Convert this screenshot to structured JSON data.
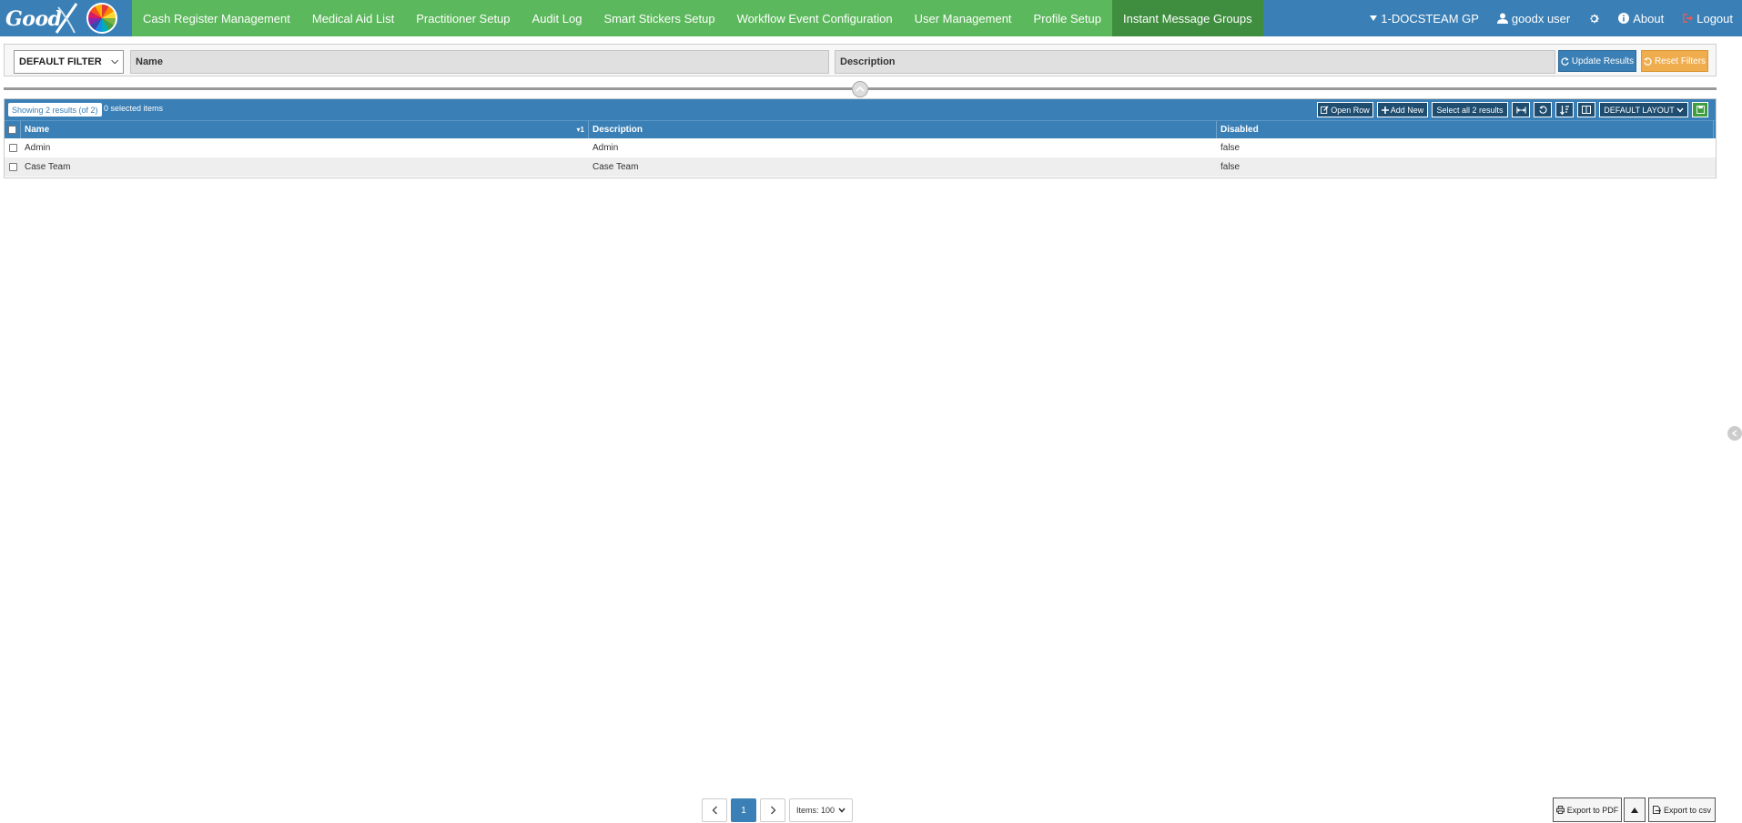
{
  "brand": {
    "logo_text": "Good"
  },
  "nav": {
    "items": [
      {
        "label": "Cash Register Management"
      },
      {
        "label": "Medical Aid List"
      },
      {
        "label": "Practitioner Setup"
      },
      {
        "label": "Audit Log"
      },
      {
        "label": "Smart Stickers Setup"
      },
      {
        "label": "Workflow Event Configuration"
      },
      {
        "label": "User Management"
      },
      {
        "label": "Profile Setup"
      },
      {
        "label": "Instant Message Groups",
        "active": true
      }
    ],
    "practice": "1-DOCSTEAM GP",
    "user": "goodx user",
    "about": "About",
    "logout": "Logout"
  },
  "filter": {
    "selected": "DEFAULT FILTER",
    "name_placeholder": "Name",
    "description_placeholder": "Description",
    "update_label": "Update Results",
    "reset_label": "Reset Filters"
  },
  "grid": {
    "showing": "Showing 2 results (of 2)",
    "selected": "0 selected items",
    "toolbar": {
      "open_row": "Open Row",
      "add_new": "Add New",
      "select_all": "Select all 2 results",
      "layout": "DEFAULT LAYOUT"
    },
    "columns": [
      "Name",
      "Description",
      "Disabled"
    ],
    "sort_indicator": "1",
    "rows": [
      {
        "name": "Admin",
        "description": "Admin",
        "disabled": "false"
      },
      {
        "name": "Case Team",
        "description": "Case Team",
        "disabled": "false"
      }
    ]
  },
  "pager": {
    "current_page": "1",
    "items": "Items: 100"
  },
  "export": {
    "pdf": "Export to PDF",
    "csv": "Export to csv"
  },
  "colors": {
    "nav_blue": "#3a7fb5",
    "nav_green": "#5cb85c",
    "reset_orange": "#f0ad4e"
  }
}
